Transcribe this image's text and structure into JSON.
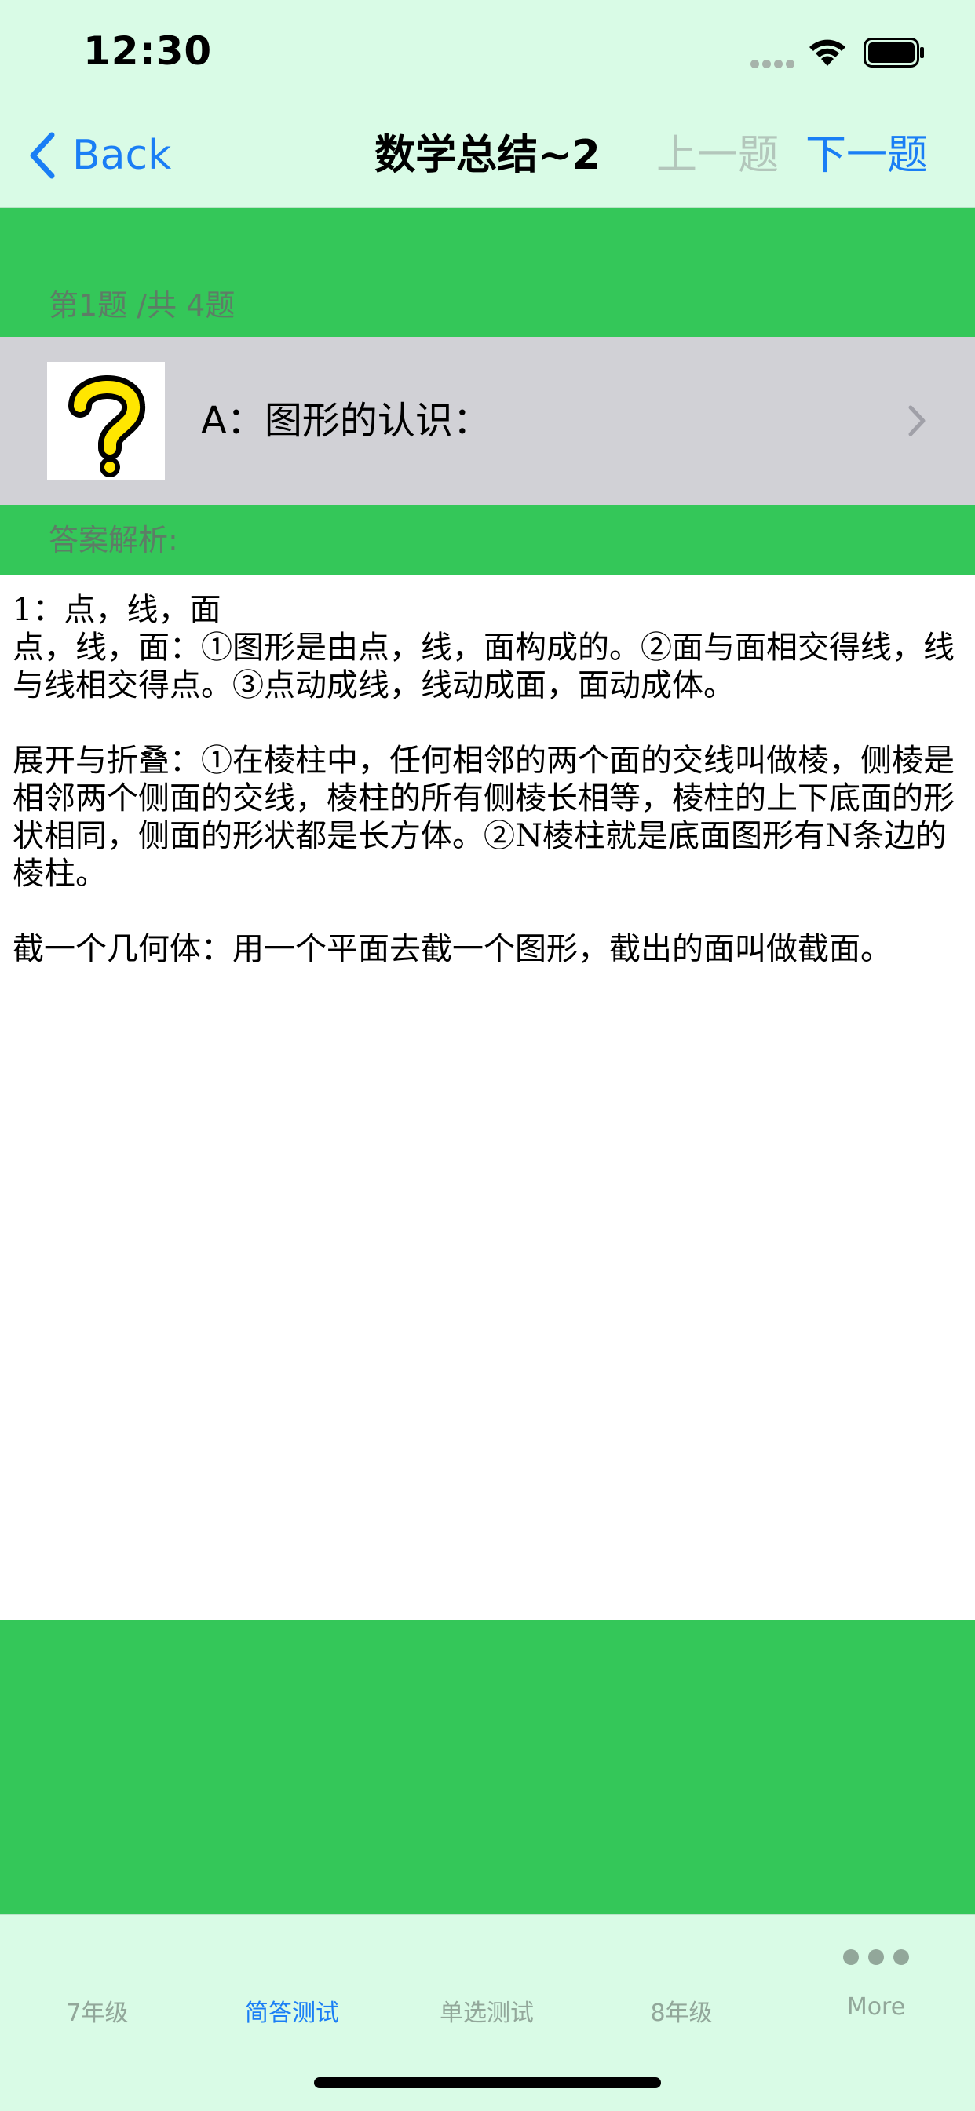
{
  "status_bar": {
    "time": "12:30"
  },
  "nav_bar": {
    "back_label": "Back",
    "title": "数学总结~2",
    "prev_label": "上一题",
    "next_label": "下一题"
  },
  "question": {
    "counter": "第1题 /共 4题",
    "text": "A：图形的认识：",
    "thumbnail_icon": "question-mark-icon"
  },
  "answer": {
    "header": "答案解析:",
    "paragraphs": [
      "1：点，线，面\n点，线，面：①图形是由点，线，面构成的。②面与面相交得线，线与线相交得点。③点动成线，线动成面，面动成体。",
      "展开与折叠：①在棱柱中，任何相邻的两个面的交线叫做棱，侧棱是相邻两个侧面的交线，棱柱的所有侧棱长相等，棱柱的上下底面的形状相同，侧面的形状都是长方体。②N棱柱就是底面图形有N条边的棱柱。",
      "截一个几何体：用一个平面去截一个图形，截出的面叫做截面。"
    ]
  },
  "tab_bar": {
    "tabs": [
      {
        "label": "7年级",
        "active": false
      },
      {
        "label": "简答测试",
        "active": true
      },
      {
        "label": "单选测试",
        "active": false
      },
      {
        "label": "8年级",
        "active": false
      },
      {
        "label": "More",
        "active": false,
        "icon": "more-dots-icon"
      }
    ]
  },
  "colors": {
    "accent_blue": "#1a7ef5",
    "band_green": "#34c759",
    "chrome_mint": "#d9fbe6",
    "row_gray": "#d1d1d6",
    "disabled_text": "#b3c6bb",
    "muted_label": "#5d7d66"
  }
}
